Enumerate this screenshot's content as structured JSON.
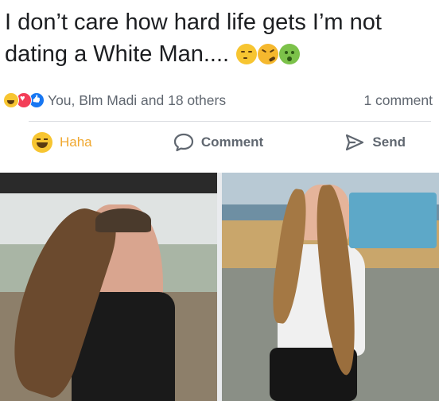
{
  "post": {
    "text": "I don’t care how hard life gets I’m not dating a White Man....",
    "emoji_icons": [
      "smirk-emoji",
      "confounded-emoji",
      "nauseated-emoji"
    ]
  },
  "reactions": {
    "icons": [
      "haha-icon",
      "heart-icon",
      "like-icon"
    ],
    "reacted_by": "You, Blm Madi and 18 others",
    "comment_count": "1 comment"
  },
  "actions": {
    "haha_label": "Haha",
    "comment_label": "Comment",
    "send_label": "Send"
  },
  "colors": {
    "haha_active": "#f0a830",
    "secondary_text": "#606770",
    "divider": "#dadde1"
  }
}
